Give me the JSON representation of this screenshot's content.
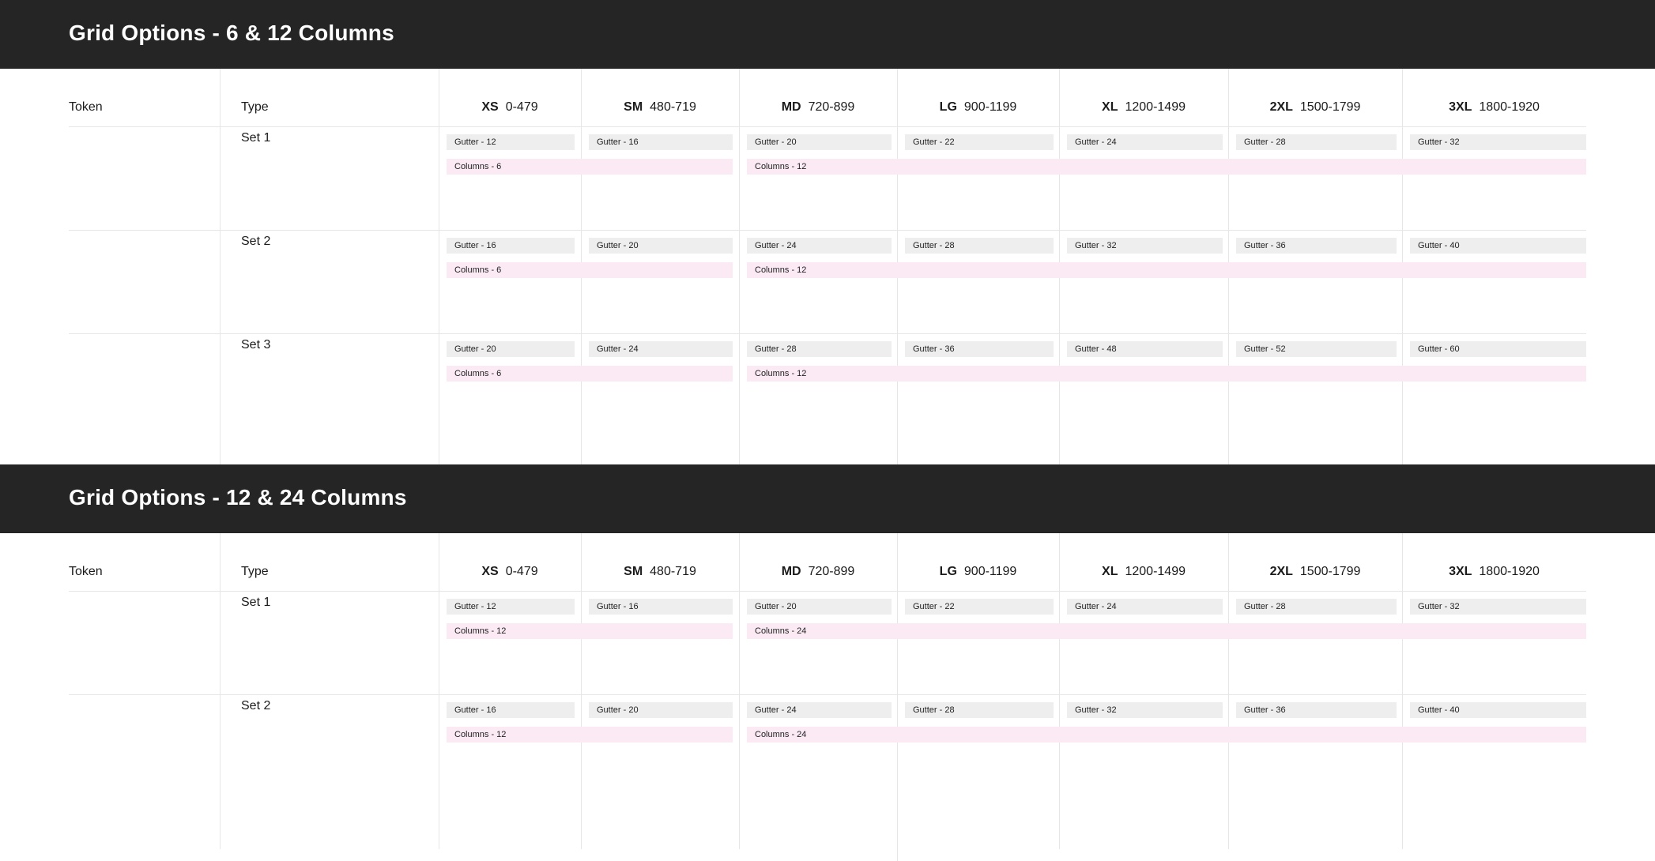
{
  "sections": [
    {
      "title": "Grid Options - 6 & 12 Columns",
      "header": {
        "token": "Token",
        "type": "Type",
        "breakpoints": [
          {
            "name": "XS",
            "range": "0-479"
          },
          {
            "name": "SM",
            "range": "480-719"
          },
          {
            "name": "MD",
            "range": "720-899"
          },
          {
            "name": "LG",
            "range": "900-1199"
          },
          {
            "name": "XL",
            "range": "1200-1499"
          },
          {
            "name": "2XL",
            "range": "1500-1799"
          },
          {
            "name": "3XL",
            "range": "1800-1920"
          }
        ]
      },
      "rows": [
        {
          "label": "Set 1",
          "gutters": [
            "Gutter - 12",
            "Gutter - 16",
            "Gutter - 20",
            "Gutter - 22",
            "Gutter - 24",
            "Gutter - 28",
            "Gutter - 32"
          ],
          "columns_small": "Columns - 6",
          "columns_large": "Columns - 12"
        },
        {
          "label": "Set 2",
          "gutters": [
            "Gutter - 16",
            "Gutter - 20",
            "Gutter - 24",
            "Gutter - 28",
            "Gutter - 32",
            "Gutter - 36",
            "Gutter - 40"
          ],
          "columns_small": "Columns - 6",
          "columns_large": "Columns - 12"
        },
        {
          "label": "Set 3",
          "gutters": [
            "Gutter - 20",
            "Gutter - 24",
            "Gutter - 28",
            "Gutter - 36",
            "Gutter - 48",
            "Gutter - 52",
            "Gutter - 60"
          ],
          "columns_small": "Columns - 6",
          "columns_large": "Columns - 12"
        }
      ]
    },
    {
      "title": "Grid Options - 12 & 24 Columns",
      "header": {
        "token": "Token",
        "type": "Type",
        "breakpoints": [
          {
            "name": "XS",
            "range": "0-479"
          },
          {
            "name": "SM",
            "range": "480-719"
          },
          {
            "name": "MD",
            "range": "720-899"
          },
          {
            "name": "LG",
            "range": "900-1199"
          },
          {
            "name": "XL",
            "range": "1200-1499"
          },
          {
            "name": "2XL",
            "range": "1500-1799"
          },
          {
            "name": "3XL",
            "range": "1800-1920"
          }
        ]
      },
      "rows": [
        {
          "label": "Set 1",
          "gutters": [
            "Gutter - 12",
            "Gutter - 16",
            "Gutter - 20",
            "Gutter - 22",
            "Gutter - 24",
            "Gutter - 28",
            "Gutter - 32"
          ],
          "columns_small": "Columns - 12",
          "columns_large": "Columns - 24"
        },
        {
          "label": "Set 2",
          "gutters": [
            "Gutter - 16",
            "Gutter - 20",
            "Gutter - 24",
            "Gutter - 28",
            "Gutter - 32",
            "Gutter - 36",
            "Gutter - 40"
          ],
          "columns_small": "Columns - 12",
          "columns_large": "Columns - 24"
        }
      ]
    }
  ]
}
